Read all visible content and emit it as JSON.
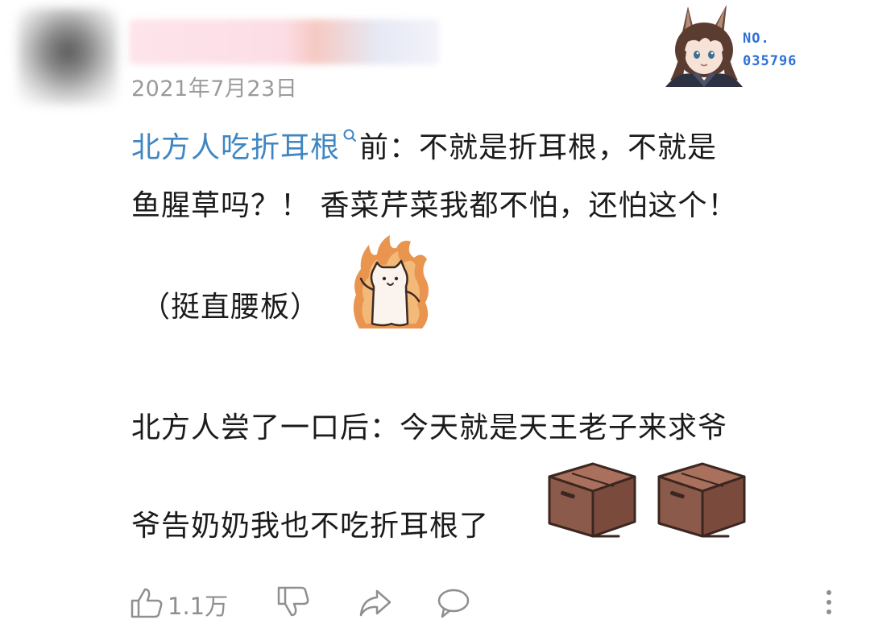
{
  "comment": {
    "date": "2021年7月23日",
    "badge": {
      "label": "NO.",
      "number": "035796"
    },
    "lines": {
      "topic_link": "北方人吃折耳根",
      "line1_rest": "前：不就是折耳根，不就是",
      "line2": "鱼腥草吗？！ 香菜芹菜我都不怕，还怕这个！",
      "line3": "（挺直腰板）",
      "line4": "北方人尝了一口后：今天就是天王老子来求爷",
      "line5": "爷告奶奶我也不吃折耳根了"
    },
    "stickers": [
      "fire-cat-sticker",
      "box-emoji",
      "box-emoji"
    ]
  },
  "actions": {
    "like_count": "1.1万",
    "icons": [
      "thumbs-up-icon",
      "thumbs-down-icon",
      "share-icon",
      "reply-icon",
      "more-icon"
    ]
  },
  "colors": {
    "link": "#3f86c2",
    "text": "#1b1b1b",
    "meta": "#9a9a9a",
    "badge": "#2f6fd6",
    "box": "#8c5a4a"
  }
}
